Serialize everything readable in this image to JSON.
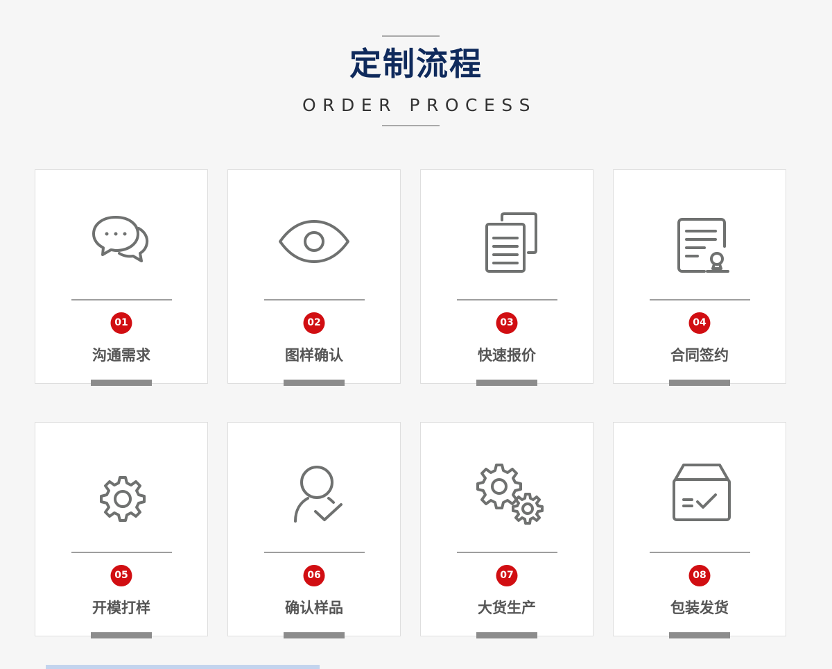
{
  "header": {
    "title": "定制流程",
    "subtitle": "ORDER PROCESS"
  },
  "colors": {
    "title": "#0f2a5c",
    "badge": "#d10e12",
    "icon": "#6f7170",
    "bar": "#8c8c8c"
  },
  "steps": [
    {
      "num": "01",
      "label": "沟通需求",
      "icon": "chat-bubbles-icon"
    },
    {
      "num": "02",
      "label": "图样确认",
      "icon": "eye-icon"
    },
    {
      "num": "03",
      "label": "快速报价",
      "icon": "documents-icon"
    },
    {
      "num": "04",
      "label": "合同签约",
      "icon": "contract-stamp-icon"
    },
    {
      "num": "05",
      "label": "开模打样",
      "icon": "gear-icon"
    },
    {
      "num": "06",
      "label": "确认样品",
      "icon": "user-check-icon"
    },
    {
      "num": "07",
      "label": "大货生产",
      "icon": "gears-icon"
    },
    {
      "num": "08",
      "label": "包装发货",
      "icon": "box-check-icon"
    }
  ]
}
